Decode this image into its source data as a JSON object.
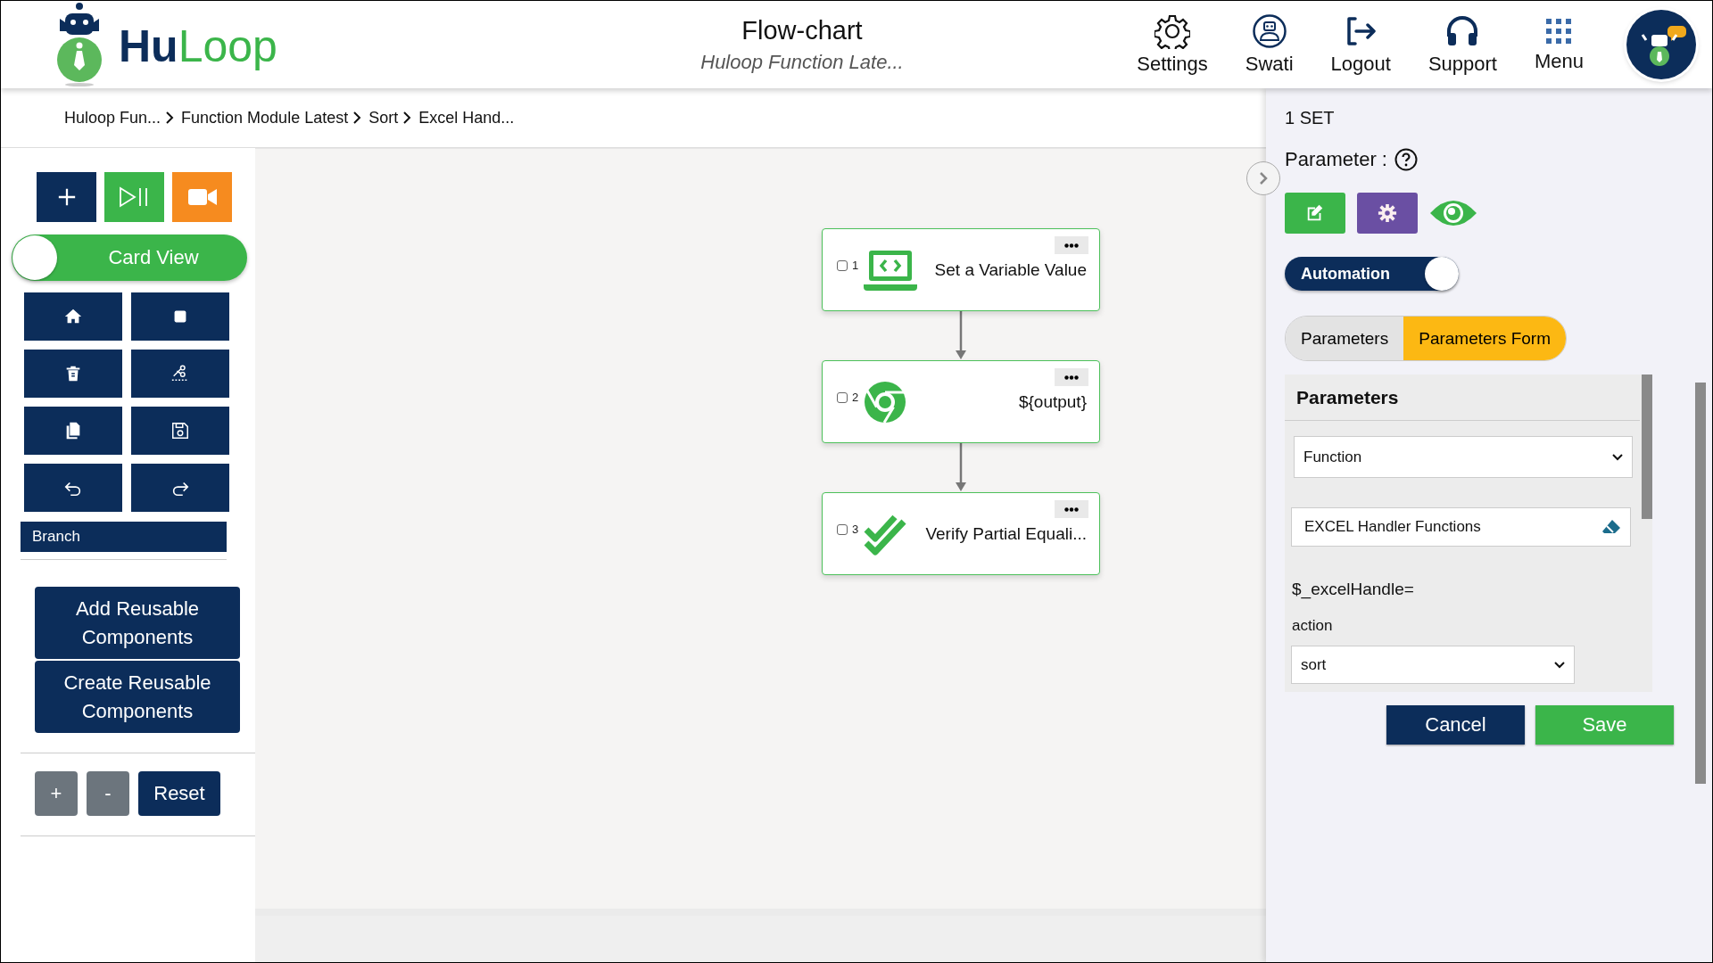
{
  "header": {
    "logo": "**Hu**Loop",
    "title": "Flow-chart",
    "subtitle": "Huloop Function Late...",
    "nav": [
      {
        "label": "Settings",
        "kind": "settings"
      },
      {
        "label": "Swati",
        "kind": "user"
      },
      {
        "label": "Logout",
        "kind": "logout"
      },
      {
        "label": "Support",
        "kind": "support"
      },
      {
        "label": "Menu",
        "kind": "menu"
      }
    ]
  },
  "breadcrumb": [
    "Huloop Fun...",
    "Function Module Latest",
    "Sort",
    "Excel Hand..."
  ],
  "toolbar": {
    "card_view": {
      "label": "Card View",
      "on": true
    },
    "branch": "Branch",
    "reusable_buttons": [
      "Add Reusable Components",
      "Create Reusable Components"
    ],
    "zoom_buttons": [
      {
        "label": "+",
        "kind": "zoom"
      },
      {
        "label": "-",
        "kind": "zoom"
      },
      {
        "label": "Reset",
        "kind": "reset"
      }
    ]
  },
  "nodes": [
    {
      "number": "1",
      "label": "Set a Variable Value",
      "kind": "variable",
      "checked": false
    },
    {
      "number": "2",
      "label": "${output}",
      "kind": "browser",
      "checked": false
    },
    {
      "number": "3",
      "label": "Verify Partial Equali...",
      "kind": "verify",
      "checked": false
    }
  ],
  "panel": {
    "step": "1 SET",
    "parameter_label": "Parameter :",
    "automation": {
      "label": "Automation",
      "on": true
    },
    "tabs": [
      {
        "label": "Parameters",
        "selected": false
      },
      {
        "label": "Parameters Form",
        "selected": true
      }
    ],
    "form": {
      "title": "Parameters",
      "function_select": "Function",
      "function_value": "EXCEL Handler Functions",
      "assignment": "$_excelHandle=",
      "action_label": "action",
      "action_select": "sort"
    },
    "buttons": [
      {
        "label": "Cancel",
        "kind": "cancel"
      },
      {
        "label": "Save",
        "kind": "save"
      }
    ]
  }
}
